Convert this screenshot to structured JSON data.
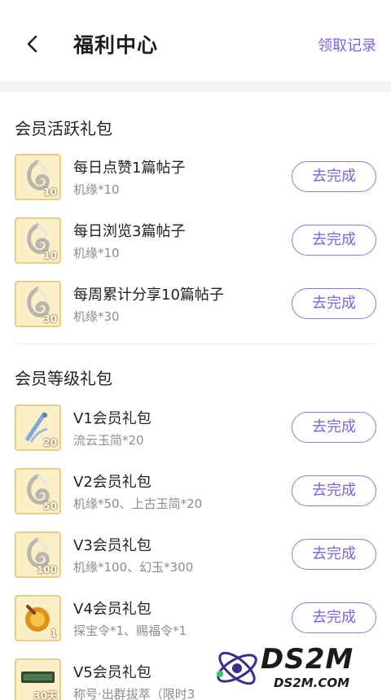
{
  "header": {
    "title": "福利中心",
    "records_label": "领取记录"
  },
  "sections": [
    {
      "title": "会员活跃礼包",
      "items": [
        {
          "title": "每日点赞1篇帖子",
          "reward": "机缘*10",
          "qty": "10",
          "icon": "jade-swirl-icon",
          "button": "去完成"
        },
        {
          "title": "每日浏览3篇帖子",
          "reward": "机缘*10",
          "qty": "10",
          "icon": "jade-swirl-icon",
          "button": "去完成"
        },
        {
          "title": "每周累计分享10篇帖子",
          "reward": "机缘*30",
          "qty": "30",
          "icon": "jade-swirl-icon",
          "button": "去完成"
        }
      ]
    },
    {
      "title": "会员等级礼包",
      "items": [
        {
          "title": "V1会员礼包",
          "reward": "流云玉简*20",
          "qty": "20",
          "icon": "jade-scroll-icon",
          "button": "去完成"
        },
        {
          "title": "V2会员礼包",
          "reward": "机缘*50、上古玉简*20",
          "qty": "50",
          "icon": "jade-swirl-icon",
          "button": "去完成"
        },
        {
          "title": "V3会员礼包",
          "reward": "机缘*100、幻玉*300",
          "qty": "100",
          "icon": "jade-swirl-icon",
          "button": "去完成"
        },
        {
          "title": "V4会员礼包",
          "reward": "探宝令*1、赐福令*1",
          "qty": "1",
          "icon": "treasure-token-icon",
          "button": "去完成"
        },
        {
          "title": "V5会员礼包",
          "reward": "称号·出群拔萃（限时3",
          "qty": "30天",
          "icon": "title-badge-icon",
          "button": ""
        }
      ]
    }
  ],
  "watermark": {
    "text": "DS2M",
    "url": "DS2M.COM"
  },
  "colors": {
    "accent": "#7f63e0",
    "icon_bg": "#fbefc8",
    "icon_border": "#e8cc88"
  }
}
